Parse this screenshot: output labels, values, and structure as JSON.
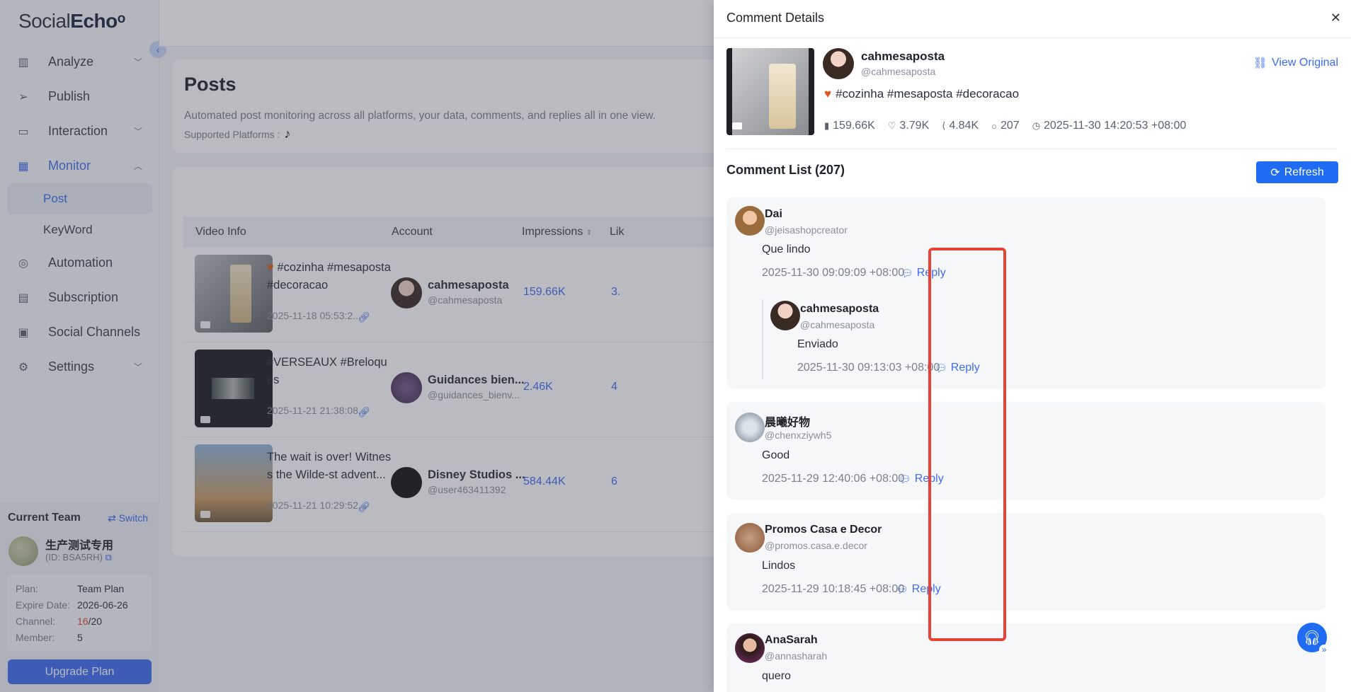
{
  "app": {
    "logo_light": "Social",
    "logo_bold": "Echo"
  },
  "sidebar": {
    "items": [
      {
        "label": "Analyze",
        "icon": "bar-chart-icon"
      },
      {
        "label": "Publish",
        "icon": "paper-plane-icon"
      },
      {
        "label": "Interaction",
        "icon": "chat-icon"
      },
      {
        "label": "Monitor",
        "icon": "line-chart-icon"
      },
      {
        "label": "Automation",
        "icon": "target-icon"
      },
      {
        "label": "Subscription",
        "icon": "ticket-icon"
      },
      {
        "label": "Social Channels",
        "icon": "browser-icon"
      },
      {
        "label": "Settings",
        "icon": "gear-icon"
      }
    ],
    "monitor_sub": [
      "Post",
      "KeyWord"
    ]
  },
  "team": {
    "title": "Current Team",
    "switch": "Switch",
    "name": "生产测试专用",
    "id": "(ID: BSA5RH)",
    "plan_k": "Plan:",
    "plan_v": "Team Plan",
    "expire_k": "Expire Date:",
    "expire_v": "2026-06-26",
    "channel_k": "Channel:",
    "channel_used": "16",
    "channel_total": "/20",
    "member_k": "Member:",
    "member_v": "5",
    "upgrade": "Upgrade Plan"
  },
  "posts": {
    "title": "Posts",
    "desc": "Automated post monitoring across all platforms, your data, comments, and replies all in one view.",
    "platforms_label": "Supported Platforms :"
  },
  "table": {
    "headers": [
      "Video Info",
      "Account",
      "Impressions",
      "Lik"
    ],
    "rows": [
      {
        "title": "#cozinha #mesaposta #decoracao",
        "date": "2025-11-18 05:53:2...",
        "acc": "cahmesaposta",
        "handle": "@cahmesaposta",
        "impressions": "159.66K",
        "likes": "3."
      },
      {
        "title": "#VERSEAUX #Breloques",
        "date": "2025-11-21 21:38:08...",
        "acc": "Guidances bien...",
        "handle": "@guidances_bienv...",
        "impressions": "2.46K",
        "likes": "4"
      },
      {
        "title": "The wait is over! Witness the Wilde-st advent...",
        "date": "2025-11-21 10:29:52...",
        "acc": "Disney Studios ...",
        "handle": "@user463411392",
        "impressions": "584.44K",
        "likes": "6"
      }
    ]
  },
  "drawer": {
    "title": "Comment Details",
    "post": {
      "name": "cahmesaposta",
      "handle": "@cahmesaposta",
      "view_original": "View Original",
      "text": "#cozinha #mesaposta #decoracao",
      "views": "159.66K",
      "likes": "3.79K",
      "shares": "4.84K",
      "comments": "207",
      "time": "2025-11-30 14:20:53 +08:00"
    },
    "list_title": "Comment List (207)",
    "refresh": "Refresh",
    "reply_label": "Reply",
    "comments": [
      {
        "name": "Dai",
        "handle": "@jeisashopcreator",
        "text": "Que lindo",
        "date": "2025-11-30 09:09:09 +08:00"
      },
      {
        "name": "cahmesaposta",
        "handle": "@cahmesaposta",
        "text": "Enviado",
        "date": "2025-11-30 09:13:03 +08:00"
      },
      {
        "name": "晨曦好物",
        "handle": "@chenxziywh5",
        "text": "Good",
        "date": "2025-11-29 12:40:06 +08:00"
      },
      {
        "name": "Promos Casa e Decor",
        "handle": "@promos.casa.e.decor",
        "text": "Lindos",
        "date": "2025-11-29 10:18:45 +08:00"
      },
      {
        "name": "AnaSarah",
        "handle": "@annasharah",
        "text": "quero"
      }
    ]
  },
  "colors": {
    "accent": "#3d6bf0",
    "highlight": "#e64235",
    "primary_btn": "#1f6cf2"
  }
}
